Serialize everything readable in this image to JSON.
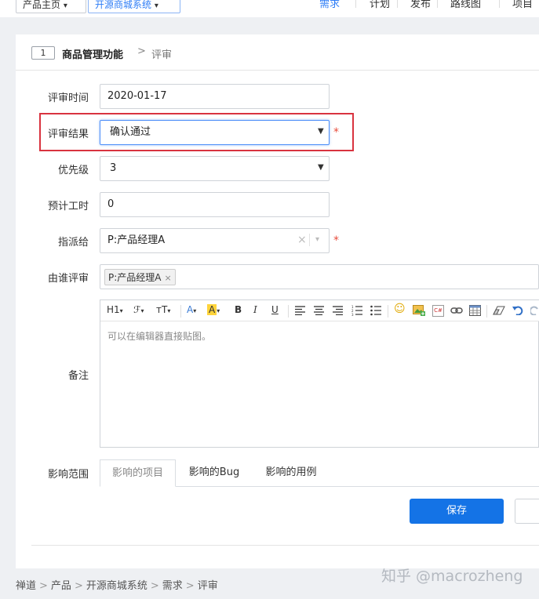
{
  "topbar": {
    "crumb_product_owner": "产品主页",
    "crumb_product": "开源商城系统",
    "nav": [
      "需求",
      "计划",
      "发布",
      "路线图",
      "项目"
    ]
  },
  "header": {
    "id": "1",
    "title": "商品管理功能",
    "separator": ">",
    "subtitle": "评审"
  },
  "form": {
    "review_date": {
      "label": "评审时间",
      "value": "2020-01-17"
    },
    "review_result": {
      "label": "评审结果",
      "value": "确认通过"
    },
    "priority": {
      "label": "优先级",
      "value": "3"
    },
    "estimate": {
      "label": "预计工时",
      "value": "0"
    },
    "assigned_to": {
      "label": "指派给",
      "value": "P:产品经理A",
      "clear": "×"
    },
    "reviewed_by": {
      "label": "由谁评审",
      "chip": "P:产品经理A",
      "chip_remove": "×"
    },
    "comment": {
      "label": "备注",
      "placeholder": "可以在编辑器直接贴图。"
    },
    "scope": {
      "label": "影响范围",
      "tabs": [
        "影响的项目",
        "影响的Bug",
        "影响的用例"
      ]
    },
    "required_mark": "*"
  },
  "toolbar": {
    "heading": "H1",
    "font": "ℱ",
    "size": "тT",
    "font_color": "A",
    "highlight": "A",
    "bold": "B",
    "italic": "I",
    "underline": "U",
    "emoji": "☺",
    "code": "C#",
    "caret": "▾"
  },
  "actions": {
    "save": "保存"
  },
  "footer": {
    "breadcrumbs": [
      "禅道",
      "产品",
      "开源商城系统",
      "需求",
      "评审"
    ],
    "watermark": "知乎 @macrozheng"
  },
  "colors": {
    "primary": "#1473e6",
    "required": "#e74c3c",
    "highlight_box": "#d9333f"
  }
}
